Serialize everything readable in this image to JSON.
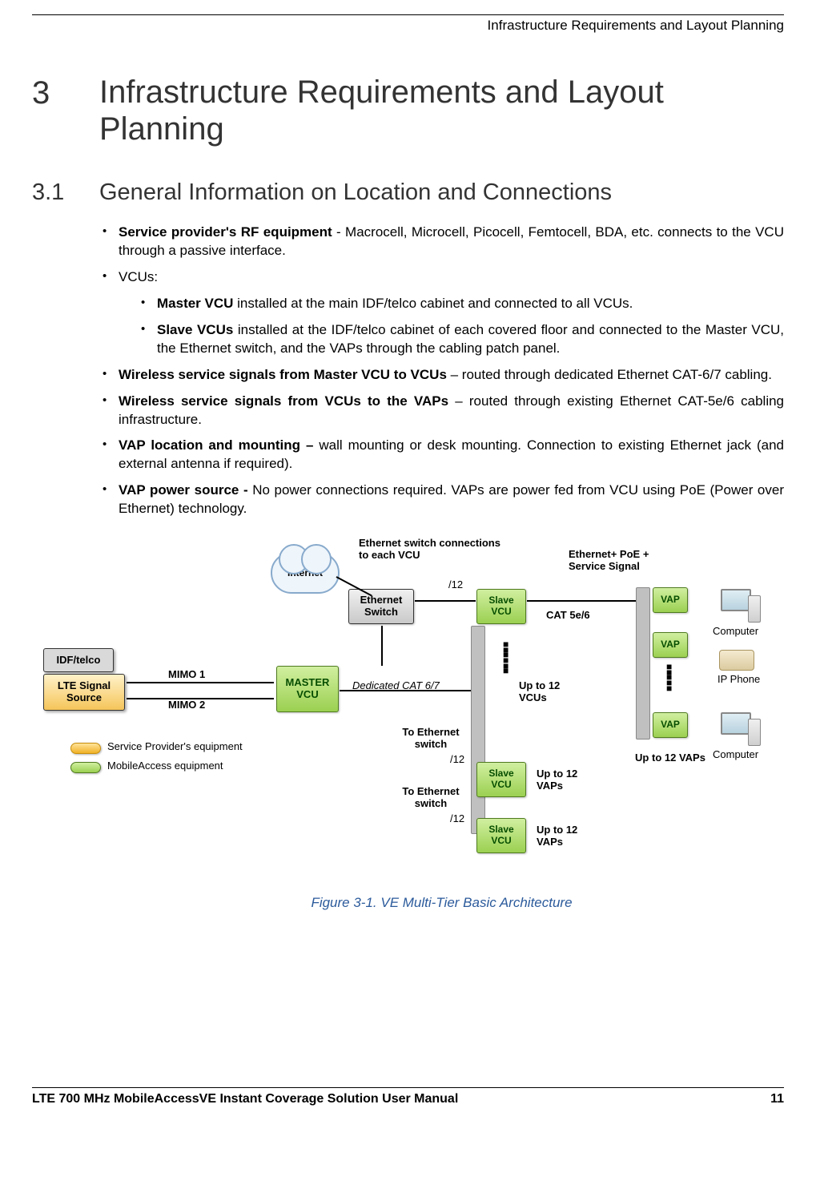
{
  "header": {
    "runningTitle": "Infrastructure Requirements and Layout Planning"
  },
  "chapter": {
    "number": "3",
    "title": "Infrastructure Requirements and Layout Planning"
  },
  "section": {
    "number": "3.1",
    "title": "General Information on Location and Connections"
  },
  "bullets": {
    "b1_bold": "Service provider's RF equipment",
    "b1_rest": " - Macrocell, Microcell, Picocell, Femtocell, BDA, etc. connects to the VCU through a passive interface.",
    "b2": "VCUs:",
    "b2a_bold": "Master VCU",
    "b2a_rest": " installed at the main IDF/telco cabinet and connected to all VCUs.",
    "b2b_bold": "Slave VCUs",
    "b2b_rest": " installed at the IDF/telco cabinet of each covered floor and connected to the Master VCU, the Ethernet switch, and the VAPs through the cabling patch panel.",
    "b3_bold": "Wireless service signals from Master VCU to VCUs",
    "b3_rest": " – routed through dedicated Ethernet CAT-6/7 cabling.",
    "b4_bold": "Wireless service signals from VCUs to the VAPs",
    "b4_rest": " – routed through existing Ethernet CAT-5e/6 cabling infrastructure.",
    "b5_bold": "VAP location and mounting –",
    "b5_rest": " wall mounting or desk mounting. Connection to existing Ethernet jack (and external antenna if required).",
    "b6_bold": "VAP power source -",
    "b6_rest": " No power connections required. VAPs are power fed from VCU using PoE (Power over Ethernet) technology."
  },
  "diagram": {
    "labels": {
      "internet": "Internet",
      "ethSwitchConn": "Ethernet switch connections to each VCU",
      "ethPoe": "Ethernet+ PoE + Service Signal",
      "ethSwitch": "Ethernet Switch",
      "slaveVcu": "Slave VCU",
      "masterVcu": "MASTER VCU",
      "idf": "IDF/telco",
      "lte": "LTE Signal Source",
      "mimo1": "MIMO 1",
      "mimo2": "MIMO 2",
      "dedicated": "Dedicated CAT 6/7",
      "cat56": "CAT 5e/6",
      "port12": "/12",
      "toEth": "To Ethernet switch",
      "upto12vcus": "Up to 12 VCUs",
      "upto12vaps": "Up to 12 VAPs",
      "vap": "VAP",
      "computer": "Computer",
      "ipphone": "IP Phone",
      "legendSP": "Service Provider's equipment",
      "legendMA": "MobileAccess equipment"
    }
  },
  "figureCaption": "Figure 3-1. VE Multi-Tier Basic Architecture",
  "footer": {
    "left": "LTE 700 MHz MobileAccessVE Instant Coverage Solution User Manual",
    "right": "11"
  }
}
